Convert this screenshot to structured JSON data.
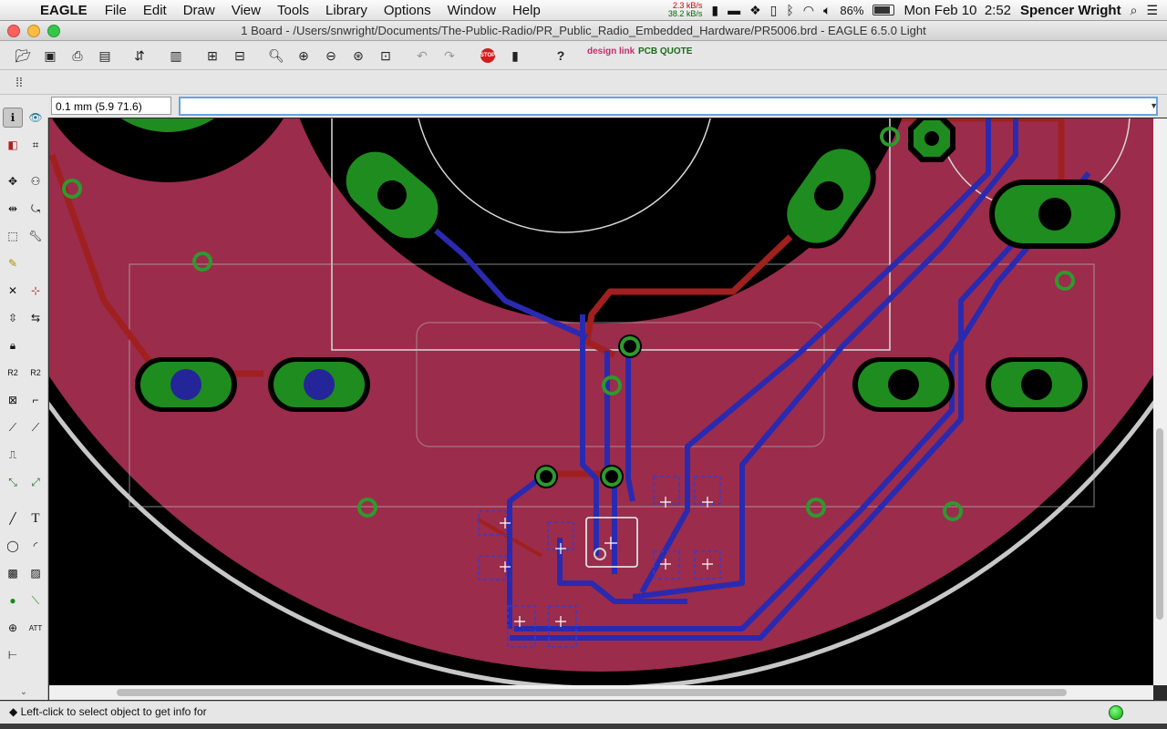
{
  "menubar": {
    "app_name": "EAGLE",
    "items": [
      "File",
      "Edit",
      "Draw",
      "View",
      "Tools",
      "Library",
      "Options",
      "Window",
      "Help"
    ],
    "net_up": "2.3 kB/s",
    "net_down": "38.2 kB/s",
    "battery": "86%",
    "datetime": "Mon Feb 10  2:52",
    "user": "Spencer Wright"
  },
  "window": {
    "title": "1 Board - /Users/snwright/Documents/The-Public-Radio/PR_Public_Radio_Embedded_Hardware/PR5006.brd - EAGLE 6.5.0 Light"
  },
  "toolbar": {
    "stop_label": "STOP",
    "help_label": "?",
    "designlink_label": "design link",
    "pcbquote_label": "PCB QUOTE"
  },
  "command": {
    "coordinates": "0.1 mm (5.9 71.6)",
    "value": ""
  },
  "status": {
    "message": "Left-click to select object to get info for"
  },
  "colors": {
    "board": "#9b2c4c",
    "pad": "#1f8c1f",
    "top_trace": "#a02020",
    "bottom_trace": "#2a2ab0",
    "outline": "#c8c8c8"
  }
}
